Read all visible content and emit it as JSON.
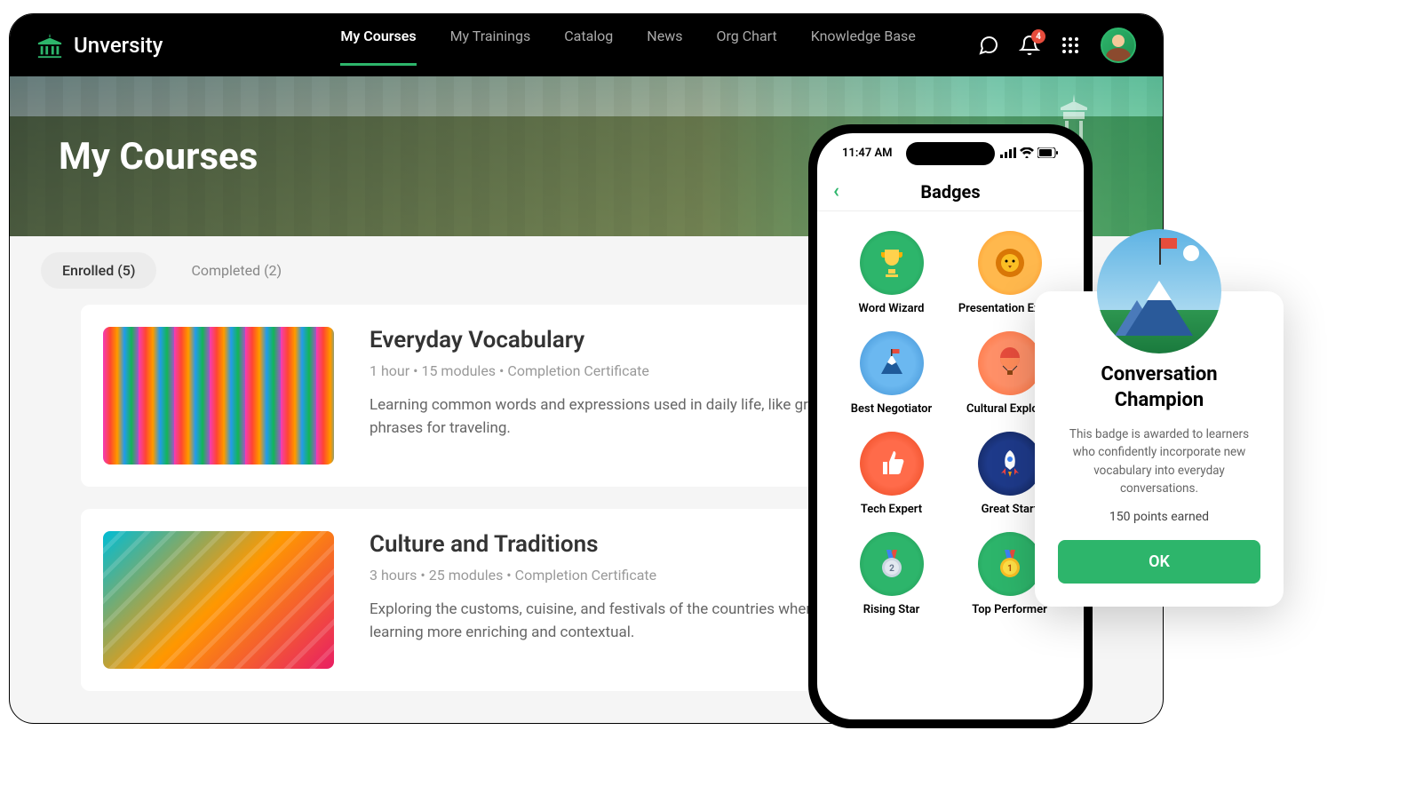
{
  "brand": "Unversity",
  "nav": {
    "items": [
      "My Courses",
      "My Trainings",
      "Catalog",
      "News",
      "Org Chart",
      "Knowledge Base"
    ],
    "active_index": 0,
    "notif_badge": "4"
  },
  "hero": {
    "title": "My Courses"
  },
  "tabs": {
    "enrolled": "Enrolled (5)",
    "completed": "Completed (2)",
    "active_index": 0
  },
  "courses": [
    {
      "title": "Everyday Vocabulary",
      "meta": "1 hour • 15 modules   •   Completion Certificate",
      "desc": "Learning common words and expressions used in daily life, like greetings, restaurant orders, and useful phrases for traveling."
    },
    {
      "title": "Culture and Traditions",
      "meta": "3 hours • 25 modules   •   Completion Certificate",
      "desc": "Exploring the customs, cuisine, and festivals of the countries where the language is spoken, making learning more enriching and contextual."
    }
  ],
  "phone": {
    "time": "11:47 AM",
    "header": "Badges",
    "badges": [
      "Word Wizard",
      "Presentation Expert",
      "Best Negotiator",
      "Cultural Explorer",
      "Tech Expert",
      "Great Start",
      "Rising Star",
      "Top Performer"
    ]
  },
  "popup": {
    "title": "Conversation Champion",
    "desc": "This badge is awarded to learners who confidently incorporate new vocabulary into everyday conversations.",
    "points": "150 points earned",
    "button": "OK"
  }
}
